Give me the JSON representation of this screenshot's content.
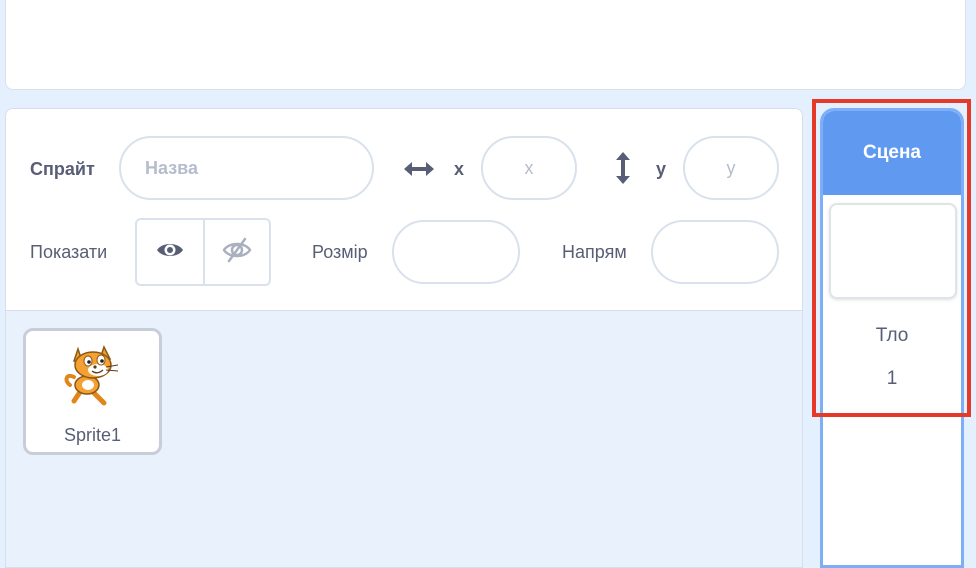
{
  "sprite_info": {
    "sprite_label": "Спрайт",
    "name_placeholder": "Назва",
    "x_label": "x",
    "x_placeholder": "x",
    "y_label": "y",
    "y_placeholder": "y",
    "show_label": "Показати",
    "size_label": "Розмір",
    "direction_label": "Напрям",
    "size_value": "",
    "direction_value": ""
  },
  "sprites": [
    {
      "name": "Sprite1"
    }
  ],
  "stage": {
    "header": "Сцена",
    "backdrops_label": "Тло",
    "backdrops_count": "1"
  },
  "colors": {
    "accent": "#5f99f0",
    "highlight": "#e53a2a",
    "text": "#575e75",
    "panel_bg": "#e9f1fc"
  },
  "icons": {
    "x_axis": "horizontal-arrows-icon",
    "y_axis": "vertical-arrows-icon",
    "show": "eye-icon",
    "hide": "eye-hidden-icon",
    "sprite": "scratch-cat-icon"
  }
}
